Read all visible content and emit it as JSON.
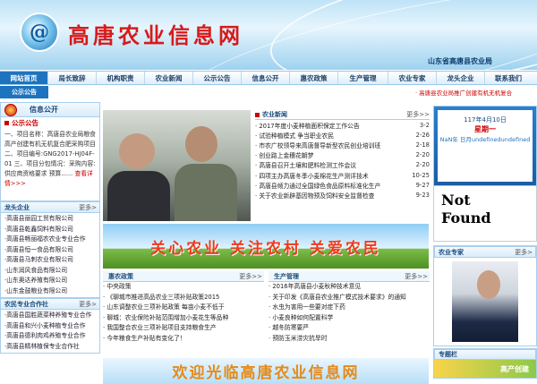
{
  "header": {
    "logo_char": "@",
    "title": "高唐农业信息网",
    "org": "山东省高唐县农业局"
  },
  "nav": [
    "网站首页",
    "局长致辞",
    "机构职责",
    "农业新闻",
    "公示公告",
    "信息公开",
    "惠农政策",
    "生产管理",
    "农业专家",
    "龙头企业",
    "联系我们"
  ],
  "subnav": {
    "home": "公示公告",
    "ticker": "· 高唐县农业局推广创建有机无机复合"
  },
  "left": {
    "info_title": "信息公开",
    "gkgg_title": "公示公告",
    "notice": "一、项目名称：高唐县农业局粮食高产创建有机无机复合肥采购项目 二、项目编号:GNG2017-HJ04F-01 三、项目分包情况：采购内容:供应商资格要求 预算......",
    "notice_link": "查看详情>>>",
    "longtou_title": "龙头企业",
    "longtou_more": "更多>",
    "longtou": [
      "·高唐县丽园工贸有限公司",
      "·高唐县乾鑫饲料有限公司",
      "·高唐县畅丽福农农业专业合作",
      "·高唐县恒一食品有限公司",
      "·高唐县马刺农业有限公司",
      "·山东润风食品有限公司",
      "·山东奥达养殖有限公司",
      "·山东金鼓粮业有限公司"
    ],
    "coop_title": "农民专业合作社",
    "coop_more": "更多>",
    "coop": [
      "·高唐县国胜蔬菜种养殖专业合作",
      "·高唐县和兴小麦种植专业合作",
      "·高唐县德利肉鸡养殖专业合作",
      "·高唐县精林植保专业合作社"
    ]
  },
  "news": {
    "title": "农业新闻",
    "more": "更多>>",
    "items": [
      {
        "t": "· 2017年度小麦种植面积保定工作公告",
        "d": "3-2"
      },
      {
        "t": "· 试验种植模式 争当职业农民",
        "d": "2-26"
      },
      {
        "t": "· 市农广校领导来高唐督导新型农民创业培训班",
        "d": "2-18"
      },
      {
        "t": "· 创业路上金穗花朝梦",
        "d": "2-20"
      },
      {
        "t": "· 高唐县召开土壤和肥料检测工作会议",
        "d": "2-20"
      },
      {
        "t": "· 四项主办高唐冬季小麦棉花生产测评技术",
        "d": "10-25"
      },
      {
        "t": "· 高唐县倾力通过全国绿色食品原料标准化生产",
        "d": "9-27"
      },
      {
        "t": "· 关于农业新辟基因物预及饲料安全监督检查",
        "d": "9-23"
      }
    ]
  },
  "banner": "关心农业 关注农村 关爱农民",
  "policy": {
    "title": "惠农政策",
    "more": "更多>>",
    "items": [
      "· 中央政策",
      "· 《聊城市推进高品农业三项补贴政策2015",
      "· 山东调整农业三项补贴政策 每亩小麦不低于",
      "· 聊城：农业保险补贴范围增加小麦花生等品种",
      "· 我国整合农业三项补贴项目支持粮食生产",
      "· 今年粮食生产补贴有变化了！"
    ]
  },
  "production": {
    "title": "生产管理",
    "more": "更多>>",
    "items": [
      "· 2016年高唐县小麦秋种技术意见",
      "· 关于印发《高唐县农业推广模式技术要求》的通知",
      "· 水虫为害用一些要对症下药",
      "· 小麦良种如何配置科学",
      "· 越冬防寒要严",
      "· 预防玉米涝灾抗旱时"
    ]
  },
  "bottom_banner": "欢迎光临高唐农业信息网",
  "right": {
    "calendar_date": "117年4月10日",
    "calendar_week": "星期一",
    "calendar_nan": "NaN年 日月undefinedundefined",
    "notfound": [
      "Not",
      "Found"
    ],
    "expert_title": "农业专家",
    "expert_more": "更多>",
    "zhuanti_title": "专题栏",
    "zhuanti_item": "高产创建"
  },
  "colors": {
    "brand_blue": "#1e73be",
    "title_red": "#d71a1a",
    "accent_orange": "#ef3a1d"
  }
}
